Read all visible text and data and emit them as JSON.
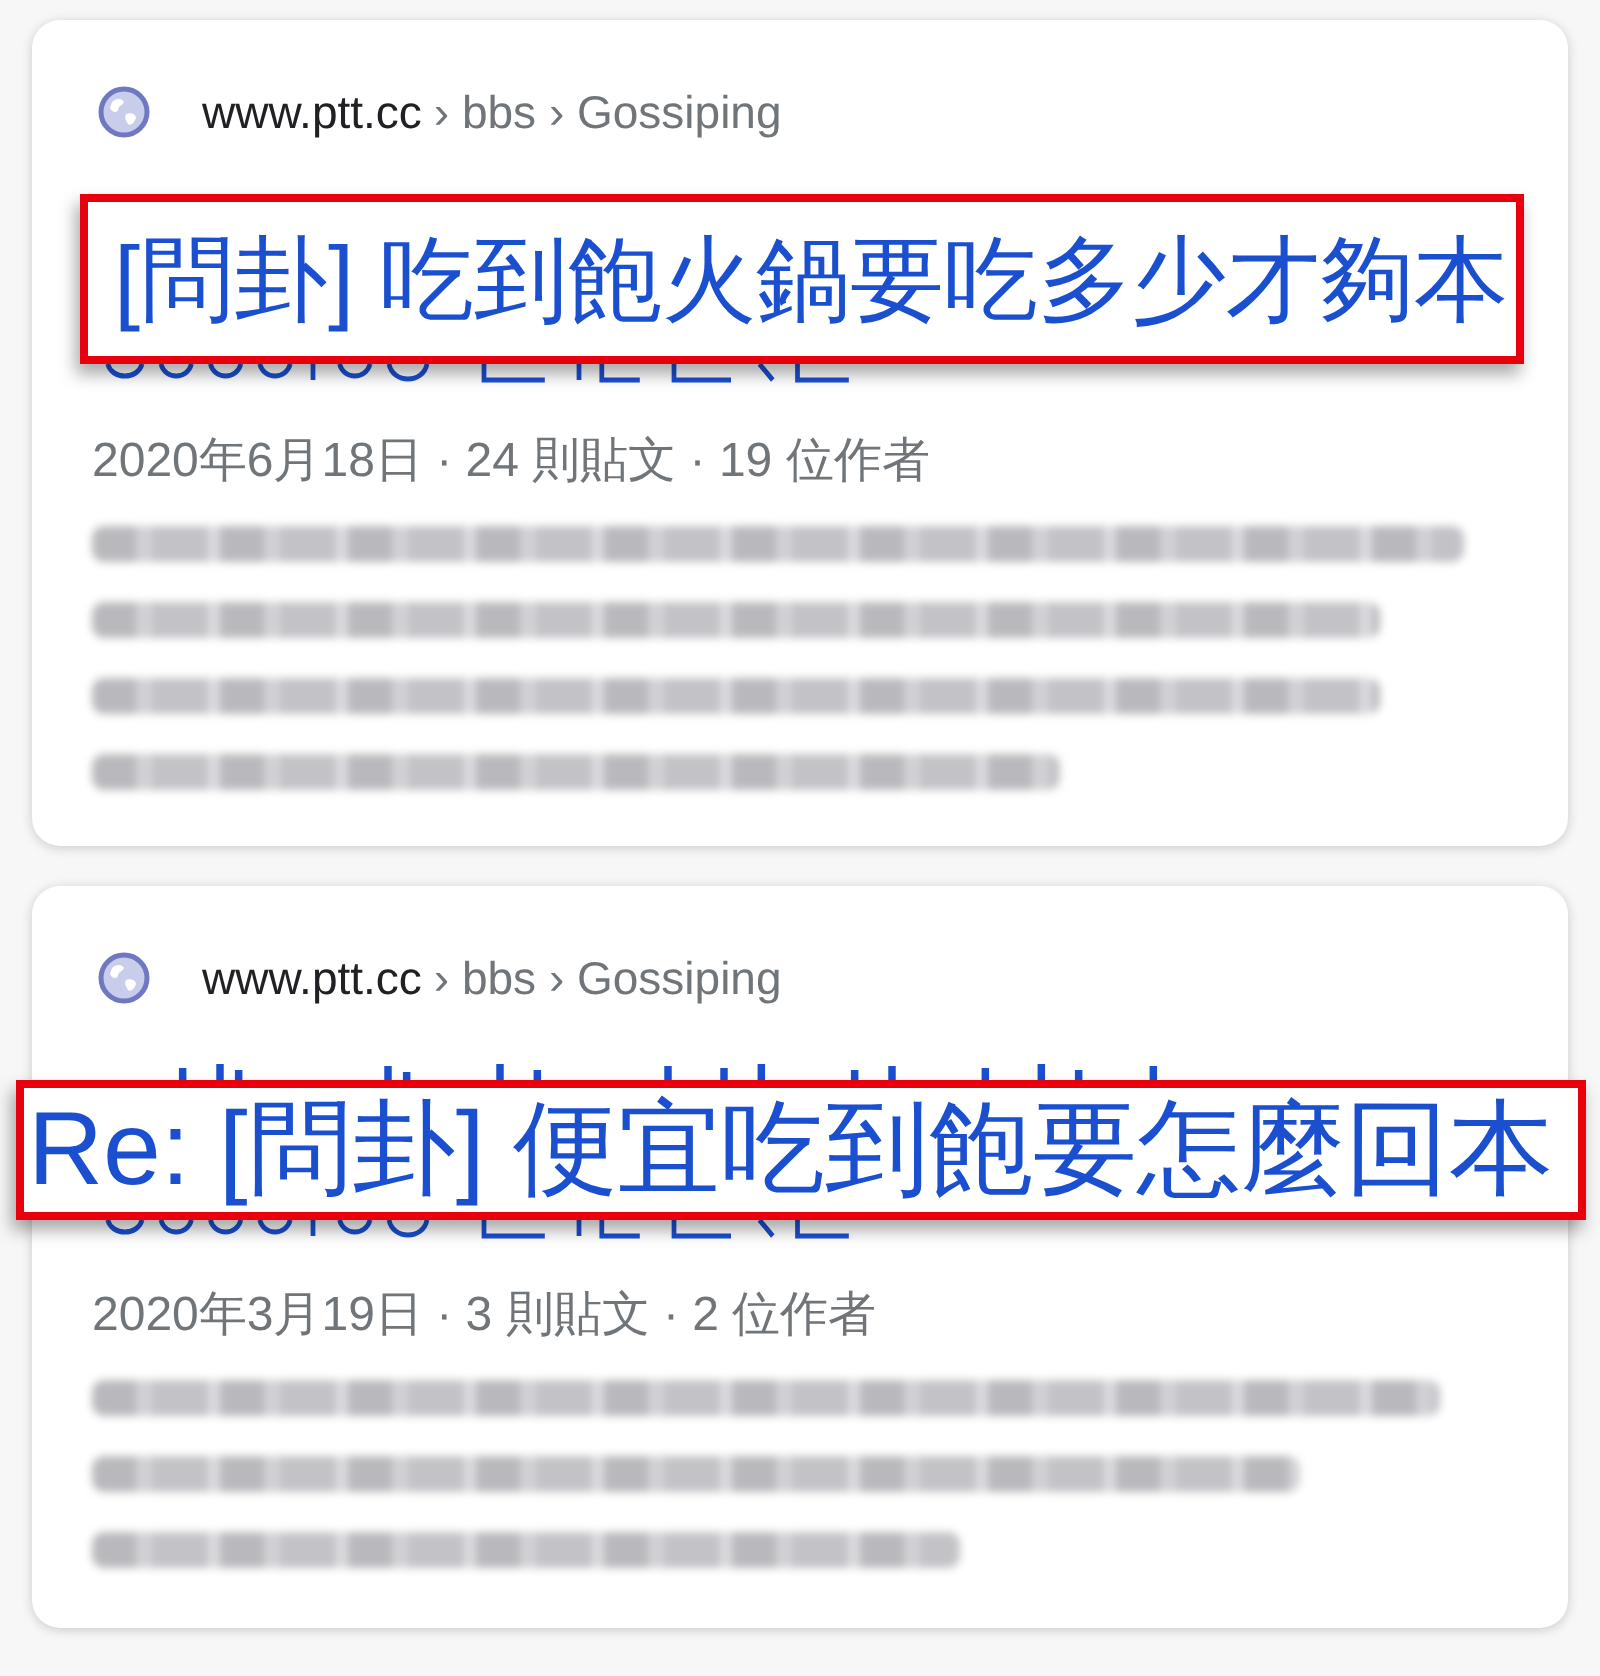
{
  "results": [
    {
      "site": "www.ptt.cc",
      "path": "› bbs › Gossiping",
      "title": "[問卦] 吃到飽火鍋要吃多少才夠本",
      "title_highlighted": true,
      "meta": "2020年6月18日 · 24 則貼文 · 19 位作者",
      "snippet_blurred": true
    },
    {
      "site": "www.ptt.cc",
      "path": "› bbs › Gossiping",
      "title": "Re: [問卦] 便宜吃到飽要怎麼回本",
      "title_highlighted": true,
      "meta": "2020年3月19日 · 3 則貼文 · 2 位作者",
      "snippet_blurred": true
    }
  ]
}
